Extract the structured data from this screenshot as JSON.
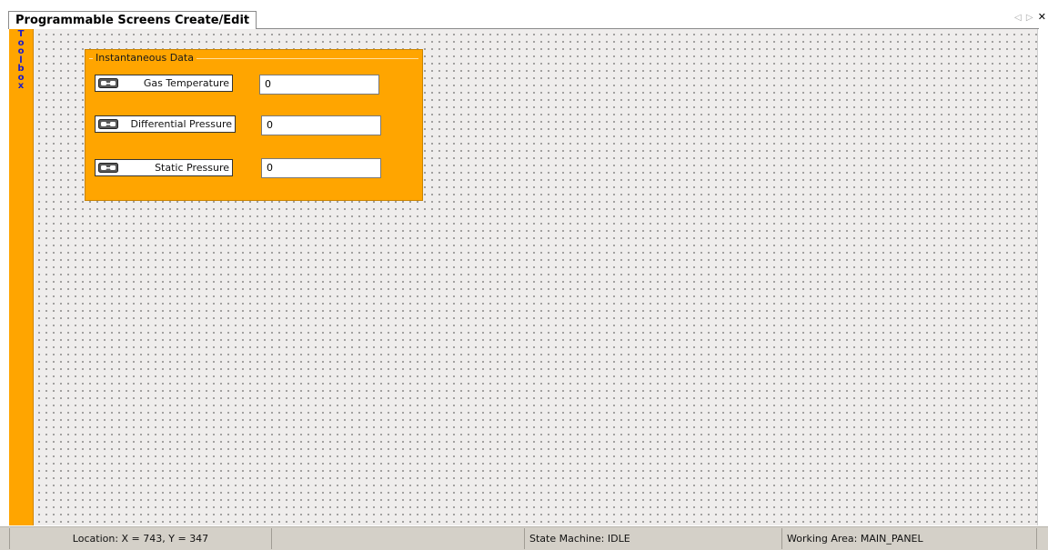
{
  "tab": {
    "title": "Programmable Screens Create/Edit",
    "controls": [
      "◁",
      "▷",
      "✕"
    ]
  },
  "toolbox": {
    "letters": [
      "T",
      "o",
      "o",
      "l",
      "b",
      "o",
      "x"
    ]
  },
  "group": {
    "title": "Instantaneous Data",
    "fields": [
      {
        "label": "Gas Temperature",
        "value": "0"
      },
      {
        "label": "Differential Pressure",
        "value": "0"
      },
      {
        "label": "Static Pressure",
        "value": "0"
      }
    ]
  },
  "status": {
    "location": "Location: X = 743, Y = 347",
    "empty": "",
    "state_machine": "State Machine: IDLE",
    "working_area": "Working Area: MAIN_PANEL"
  },
  "colors": {
    "toolbox": "#ffa500",
    "toolbox_letters": "#1c1cc8",
    "group_background": "#ffa500",
    "canvas": "#efedec",
    "statusbar": "#d4d0c8"
  },
  "icons": {
    "field_label_icon": "link-chain-icon",
    "tab_scroll_left": "triangle-left-icon",
    "tab_scroll_right": "triangle-right-icon",
    "tab_close": "close-icon"
  }
}
